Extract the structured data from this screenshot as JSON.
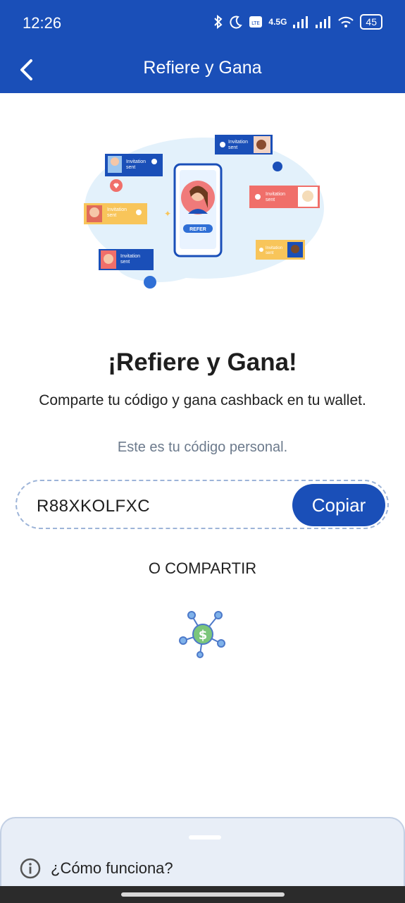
{
  "status_bar": {
    "time": "12:26",
    "network": "4.5G",
    "battery": "45"
  },
  "app_bar": {
    "title": "Refiere y Gana",
    "back_icon": "chevron-left-icon"
  },
  "illustration": {
    "bubble_text_line1": "Invitation",
    "bubble_text_line2": "sent",
    "phone_button": "REFER"
  },
  "main": {
    "headline": "¡Refiere y Gana!",
    "subheadline": "Comparte tu código y gana cashback en tu wallet.",
    "code_caption": "Este es tu código personal.",
    "code_value": "R88XKOLFXC",
    "copy_label": "Copiar",
    "share_label": "O COMPARTIR",
    "share_icon": "share-network-dollar-icon"
  },
  "bottom_sheet": {
    "how_label": "¿Cómo funciona?",
    "info_icon": "info-icon"
  },
  "colors": {
    "primary": "#1a4fb8",
    "sheet_bg": "#e8eef7",
    "caption": "#6c7a8c"
  }
}
